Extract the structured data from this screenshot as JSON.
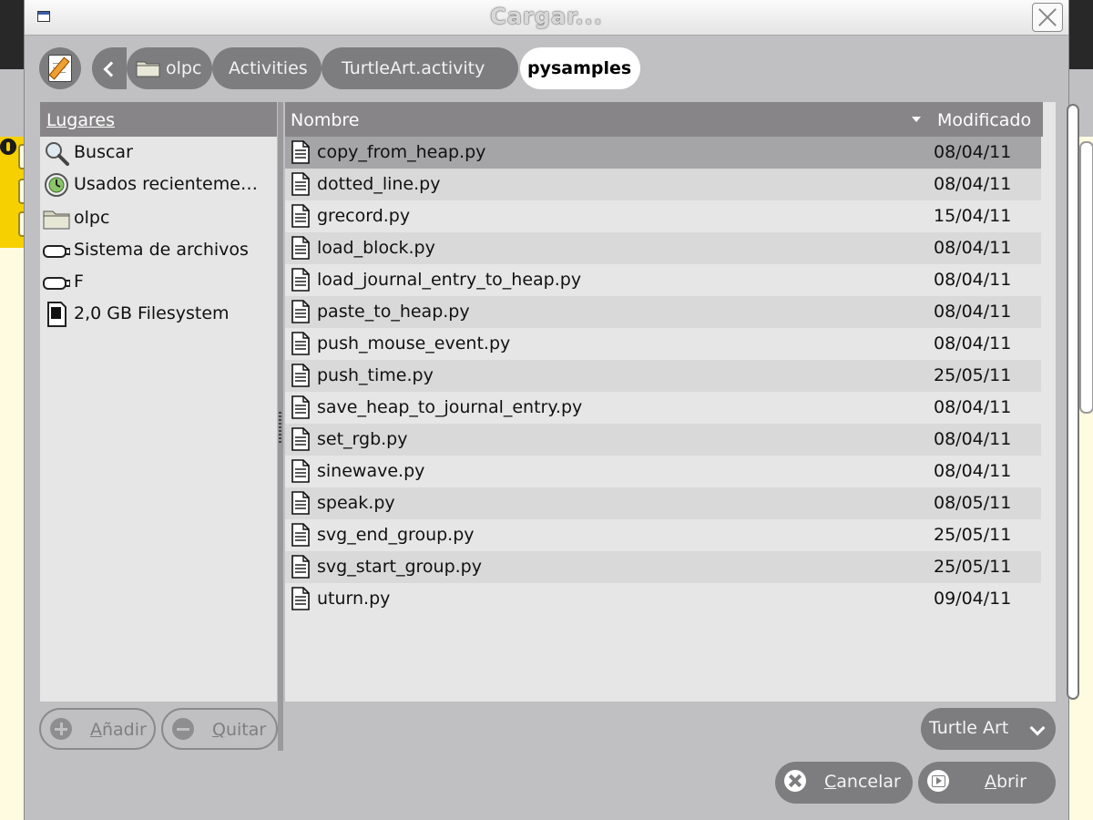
{
  "window": {
    "title": "Cargar..."
  },
  "path_bar": {
    "crumbs": [
      "olpc",
      "Activities",
      "TurtleArt.activity",
      "pysamples"
    ]
  },
  "places": {
    "header": "Lugares",
    "items": [
      {
        "label": "Buscar",
        "icon": "search-icon"
      },
      {
        "label": "Usados recienteme…",
        "icon": "recent-icon"
      },
      {
        "label": "olpc",
        "icon": "folder-icon"
      },
      {
        "label": "Sistema de archivos",
        "icon": "drive-icon"
      },
      {
        "label": "F",
        "icon": "usb-drive-icon"
      },
      {
        "label": "2,0 GB Filesystem",
        "icon": "sd-card-icon"
      }
    ],
    "add_label": "Añadir",
    "remove_label": "Quitar"
  },
  "files": {
    "columns": {
      "name": "Nombre",
      "modified": "Modificado"
    },
    "rows": [
      {
        "name": "copy_from_heap.py",
        "date": "08/04/11"
      },
      {
        "name": "dotted_line.py",
        "date": "08/04/11"
      },
      {
        "name": "grecord.py",
        "date": "15/04/11"
      },
      {
        "name": "load_block.py",
        "date": "08/04/11"
      },
      {
        "name": "load_journal_entry_to_heap.py",
        "date": "08/04/11"
      },
      {
        "name": "paste_to_heap.py",
        "date": "08/04/11"
      },
      {
        "name": "push_mouse_event.py",
        "date": "08/04/11"
      },
      {
        "name": "push_time.py",
        "date": "25/05/11"
      },
      {
        "name": "save_heap_to_journal_entry.py",
        "date": "08/04/11"
      },
      {
        "name": "set_rgb.py",
        "date": "08/04/11"
      },
      {
        "name": "sinewave.py",
        "date": "08/04/11"
      },
      {
        "name": "speak.py",
        "date": "08/05/11"
      },
      {
        "name": "svg_end_group.py",
        "date": "25/05/11"
      },
      {
        "name": "svg_start_group.py",
        "date": "25/05/11"
      },
      {
        "name": "uturn.py",
        "date": "09/04/11"
      }
    ]
  },
  "filter": {
    "selected": "Turtle Art"
  },
  "actions": {
    "cancel_label": "Cancelar",
    "open_label": "Abrir"
  },
  "colors": {
    "bar": "#7d7c7e",
    "header": "#878587",
    "dialog_bg": "#c0bfc1",
    "list_bg": "#e6e6e6"
  }
}
